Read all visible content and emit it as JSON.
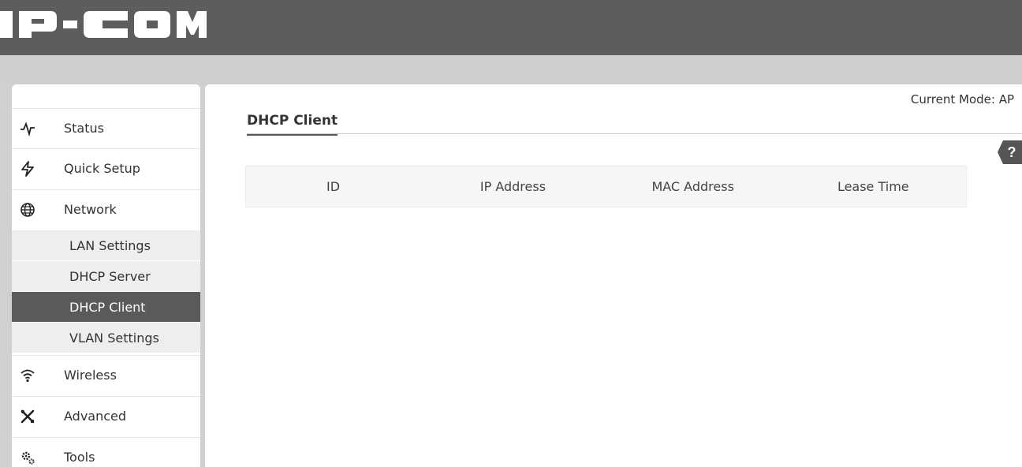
{
  "app": {
    "logo_text": "IP-COM"
  },
  "header": {
    "current_mode_label": "Current Mode: AP"
  },
  "sidebar": {
    "items": [
      {
        "label": "Status",
        "icon": "pulse-icon"
      },
      {
        "label": "Quick Setup",
        "icon": "lightning-icon"
      },
      {
        "label": "Network",
        "icon": "globe-icon"
      },
      {
        "label": "Wireless",
        "icon": "wifi-icon"
      },
      {
        "label": "Advanced",
        "icon": "tools-cross-icon"
      },
      {
        "label": "Tools",
        "icon": "gears-icon"
      }
    ],
    "network_sub": [
      {
        "label": "LAN Settings",
        "active": false
      },
      {
        "label": "DHCP Server",
        "active": false
      },
      {
        "label": "DHCP Client",
        "active": true
      },
      {
        "label": "VLAN Settings",
        "active": false
      }
    ]
  },
  "main": {
    "title": "DHCP Client",
    "help_label": "?",
    "table": {
      "columns": [
        "ID",
        "IP Address",
        "MAC Address",
        "Lease Time"
      ],
      "rows": []
    }
  },
  "colors": {
    "header_bg": "#5d5d5d",
    "active_bg": "#5a5a5a",
    "sub_bg": "#eeeeee"
  }
}
